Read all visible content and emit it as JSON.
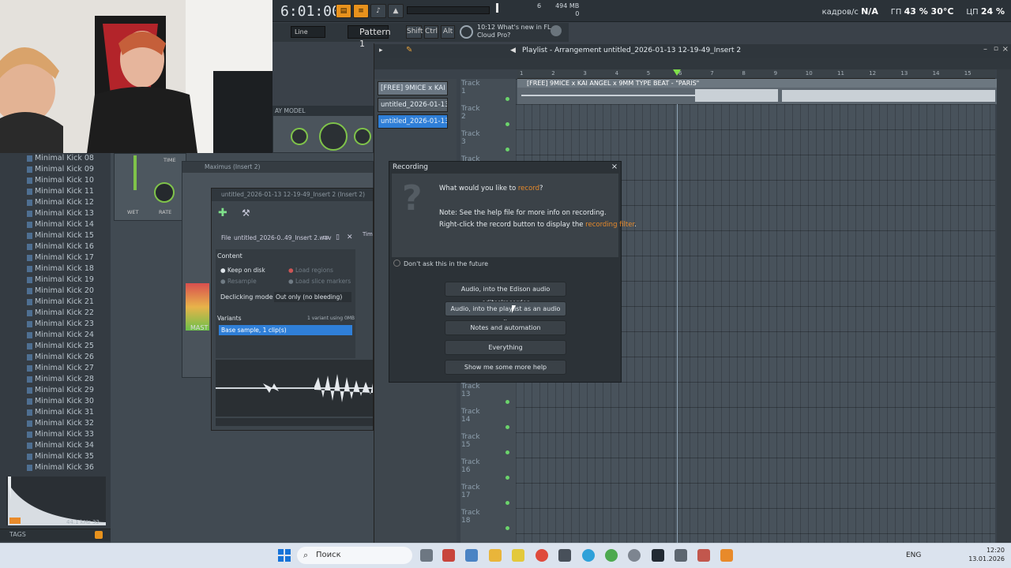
{
  "topbar": {
    "clock": "6:01:00",
    "cpu_top": "6",
    "mem": "494 MB",
    "cpu_bottom": "0",
    "fps_label": "кадров/с",
    "fps_value": "N/A",
    "gpu_label": "ГП",
    "gpu_value": "43 % 30°C",
    "cpu_label": "ЦП",
    "cpu_value": "24 %"
  },
  "toolbar2": {
    "line_mode": "Line",
    "pattern": "Pattern 1",
    "mods": [
      "Shift",
      "Ctrl",
      "Alt"
    ],
    "news_time": "10:12",
    "news_line1": "What's new in FL",
    "news_line2": "Cloud Pro?"
  },
  "browser": {
    "items": [
      "Minimal Kick 08",
      "Minimal Kick 09",
      "Minimal Kick 10",
      "Minimal Kick 11",
      "Minimal Kick 12",
      "Minimal Kick 13",
      "Minimal Kick 14",
      "Minimal Kick 15",
      "Minimal Kick 16",
      "Minimal Kick 17",
      "Minimal Kick 18",
      "Minimal Kick 19",
      "Minimal Kick 20",
      "Minimal Kick 21",
      "Minimal Kick 22",
      "Minimal Kick 23",
      "Minimal Kick 24",
      "Minimal Kick 25",
      "Minimal Kick 26",
      "Minimal Kick 27",
      "Minimal Kick 28",
      "Minimal Kick 29",
      "Minimal Kick 30",
      "Minimal Kick 31",
      "Minimal Kick 32",
      "Minimal Kick 33",
      "Minimal Kick 34",
      "Minimal Kick 35",
      "Minimal Kick 36"
    ],
    "sample_info": "44.1 kHz 32",
    "tags": "TAGS"
  },
  "plugins": {
    "delay_title": "AY MODEL",
    "wet": "WET",
    "rate": "RATE",
    "time": "TIME",
    "maximus": "Maximus (Insert 2)",
    "master": "MAST"
  },
  "insert_window": {
    "title": "untitled_2026-01-13 12-19-49_Insert 2 (Insert 2)",
    "file_label": "File",
    "file_name": "untitled_2026-0..49_Insert 2.wav",
    "time_label": "Tim",
    "content_label": "Content",
    "keep_on_disk": "Keep on disk",
    "load_regions": "Load regions",
    "resample": "Resample",
    "load_slice_markers": "Load slice markers",
    "declicking_label": "Declicking mode",
    "declicking_value": "Out only (no bleeding)",
    "variants_label": "Variants",
    "variants_info": "1 variant using 0MB",
    "variant_item": "Base sample, 1 clip(s)"
  },
  "playlist": {
    "title": "Playlist - Arrangement",
    "breadcrumb": "untitled_2026-01-13 12-19-49_Insert 2",
    "patterns": [
      "[FREE] 9MICE x KAI A...",
      "untitled_2026-01-13 12-...",
      "untitled_2026-01-13 12-..."
    ],
    "tracks": [
      "Track 1",
      "Track 2",
      "Track 3",
      "Track 4",
      "Track 13",
      "Track 14",
      "Track 15",
      "Track 16",
      "Track 17",
      "Track 18"
    ],
    "ruler": [
      "1",
      "2",
      "3",
      "4",
      "5",
      "6",
      "7",
      "8",
      "9",
      "10",
      "11",
      "12",
      "13",
      "14",
      "15"
    ],
    "clip_title": "[FREE] 9MICE x KAI ANGEL x 9MM TYPE BEAT - \"PARIS\""
  },
  "dialog": {
    "title": "Recording",
    "close": "×",
    "question_pre": "What would you like to ",
    "question_link": "record",
    "question_post": "?",
    "note": "Note: See the help file for more info on recording.",
    "hint_pre": "Right-click the record button to display the ",
    "hint_link": "recording filter",
    "hint_post": ".",
    "checkbox": "Don't ask this in the future",
    "buttons": [
      "Audio, into the Edison audio editor/recorder",
      "Audio, into the playlist as an audio clip",
      "Notes and automation",
      "Everything",
      "Show me some more help"
    ]
  },
  "taskbar": {
    "search": "Поиск",
    "lang": "ENG",
    "time": "12:20",
    "date": "13.01.2026"
  },
  "colors": {
    "accent": "#e88a2a",
    "selection": "#2f7fd8",
    "led": "#6bd46b"
  }
}
